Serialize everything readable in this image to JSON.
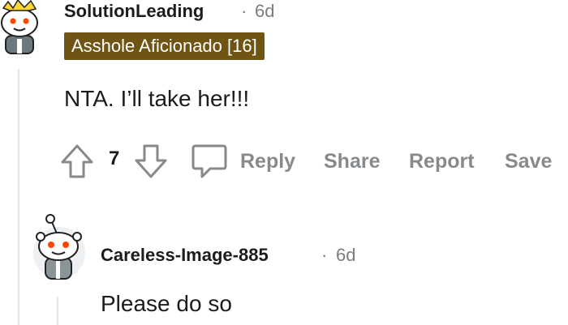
{
  "comment": {
    "username": "SolutionLeading",
    "separator": "·",
    "time": "6d",
    "flair": "Asshole Aficionado [16]",
    "flair_color": "#6f5413",
    "body": "NTA. I’ll take her!!!",
    "vote_count": "7",
    "actions": {
      "reply": "Reply",
      "share": "Share",
      "report": "Report",
      "save": "Save"
    },
    "icons": {
      "avatar": "snoo-avatar-icon",
      "upvote": "arrow-up-icon",
      "downvote": "arrow-down-icon",
      "reply": "speech-bubble-icon"
    }
  },
  "reply": {
    "username": "Careless-Image-885",
    "separator": "·",
    "time": "6d",
    "body": "Please do so",
    "icons": {
      "avatar": "snoo-avatar-icon"
    }
  },
  "colors": {
    "text": "#1c1c1c",
    "meta": "#7c7c7c",
    "action": "#878a8c",
    "thread_line": "#e6e6e6",
    "snoo_eye": "#ff4500"
  }
}
